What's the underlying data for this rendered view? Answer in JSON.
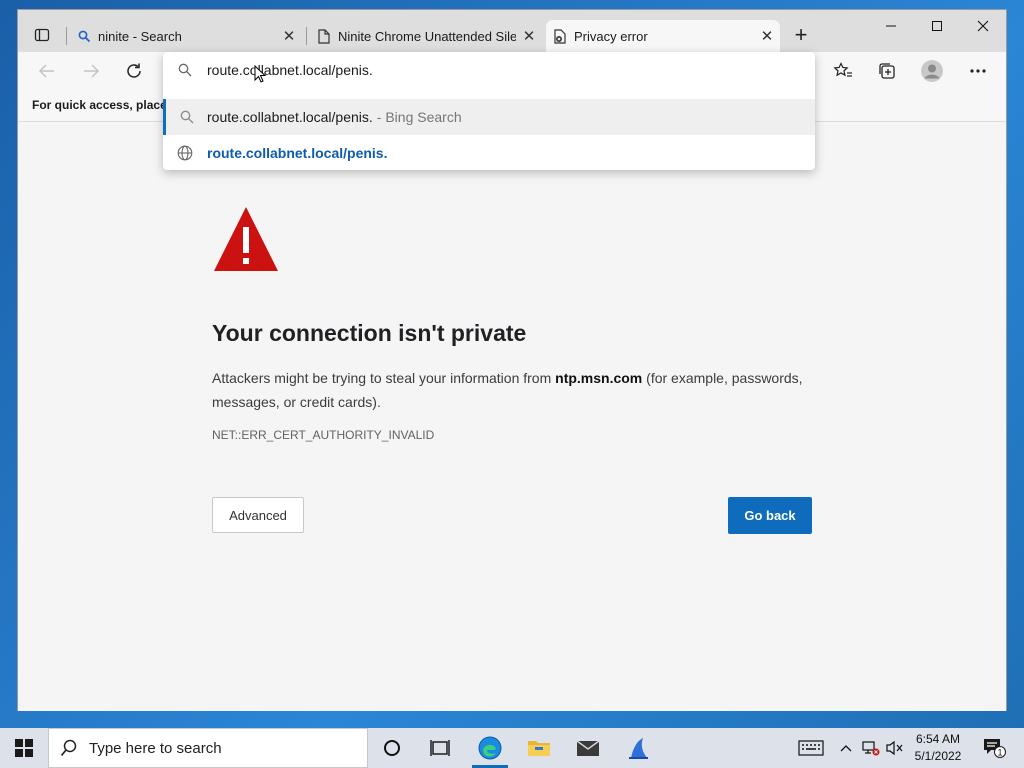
{
  "browser": {
    "tabs": [
      {
        "title": "ninite - Search",
        "close": "✕"
      },
      {
        "title": "Ninite Chrome Unattended Silen",
        "close": "✕"
      },
      {
        "title": "Privacy error",
        "close": "✕"
      }
    ],
    "new_tab": "+",
    "favorites_bar_text": "For quick access, place y",
    "omnibox": {
      "input": "route.collabnet.local/penis.",
      "suggestions": [
        {
          "text": "route.collabnet.local/penis.",
          "hint": "- Bing Search"
        },
        {
          "text": "route.collabnet.local/penis."
        }
      ]
    }
  },
  "page": {
    "title": "Your connection isn't private",
    "desc_prefix": "Attackers might be trying to steal your information from",
    "desc_domain": "ntp.msn.com",
    "desc_suffix": "(for example, passwords, messages, or credit cards).",
    "error_code": "NET::ERR_CERT_AUTHORITY_INVALID",
    "advanced_label": "Advanced",
    "go_back_label": "Go back"
  },
  "taskbar": {
    "search_placeholder": "Type here to search",
    "time": "6:54 AM",
    "date": "5/1/2022",
    "notification_count": "1"
  },
  "colors": {
    "accent": "#0f6cbd",
    "warning_red": "#cc1111",
    "taskbar": "#dce1ea"
  }
}
